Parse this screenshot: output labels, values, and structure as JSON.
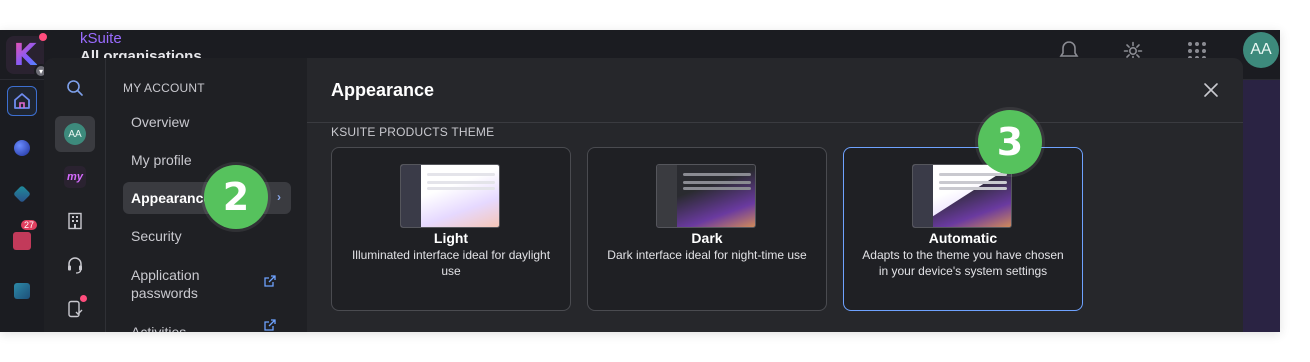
{
  "topbar": {
    "brand": "kSuite",
    "org_name": "All organisations",
    "avatar_initials": "AA",
    "icons": [
      "bell-icon",
      "gear-icon",
      "grid-apps-icon"
    ]
  },
  "rail": {
    "icons": [
      "home-icon",
      "drive-icon",
      "kchat-icon",
      "calendar-icon",
      "kdrive-box-icon"
    ],
    "calendar_badge": "27"
  },
  "modal": {
    "side_icons": [
      "search-icon",
      "avatar",
      "my-ksuite-icon",
      "building-icon",
      "headset-icon",
      "device-icon"
    ],
    "avatar_initials": "AA",
    "my_logo_text": "my",
    "nav": {
      "heading": "MY ACCOUNT",
      "items": [
        {
          "label": "Overview"
        },
        {
          "label": "My profile"
        },
        {
          "label": "Appearance"
        },
        {
          "label": "Security"
        },
        {
          "label": "Application passwords"
        },
        {
          "label": "Activities"
        }
      ],
      "active_chevron": "›"
    },
    "title": "Appearance",
    "section_label": "KSUITE PRODUCTS THEME",
    "themes": [
      {
        "name": "Light",
        "description": "Illuminated interface ideal for daylight use"
      },
      {
        "name": "Dark",
        "description": "Dark interface ideal for night-time use"
      },
      {
        "name": "Automatic",
        "description": "Adapts to the theme you have chosen in your device's system settings",
        "selected": true
      }
    ]
  },
  "steps": {
    "step2": "2",
    "step3": "3"
  },
  "colors": {
    "accent": "#6ea2ff",
    "step_green": "#56c25d",
    "brand_purple": "#9a6bff"
  }
}
